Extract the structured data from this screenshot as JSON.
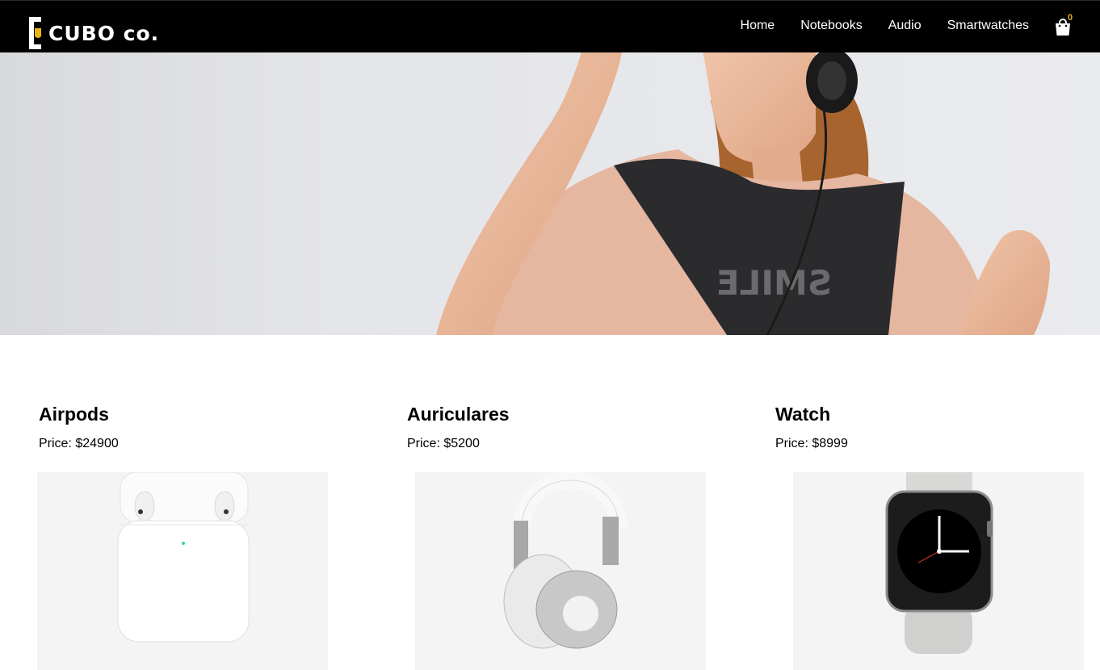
{
  "brand": {
    "name": "CUBO co."
  },
  "nav": {
    "links": [
      "Home",
      "Notebooks",
      "Audio",
      "Smartwatches"
    ],
    "cart_count": "0"
  },
  "products": [
    {
      "title": "Airpods",
      "price": "Price: $24900",
      "image": "airpods-case-image"
    },
    {
      "title": "Auriculares",
      "price": "Price: $5200",
      "image": "headphones-image"
    },
    {
      "title": "Watch",
      "price": "Price: $8999",
      "image": "smartwatch-image"
    }
  ],
  "colors": {
    "navbar": "#000000",
    "cart_badge": "#e9b613",
    "card_bg": "#f4f4f4"
  }
}
